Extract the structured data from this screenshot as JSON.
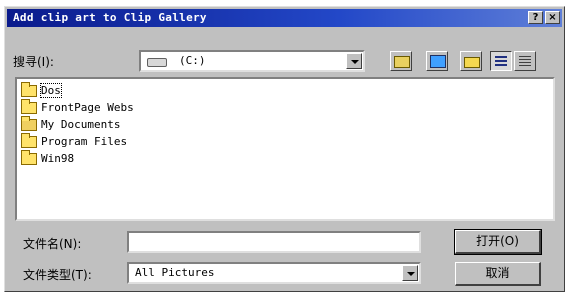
{
  "window": {
    "title": "Add clip art to Clip Gallery",
    "help_label": "?",
    "close_label": "×"
  },
  "lookin": {
    "label": "搜寻(I):",
    "value": "(C:)"
  },
  "toolbar": {
    "icons": [
      "up-folder-icon",
      "desktop-icon",
      "new-folder-icon",
      "list-view-icon",
      "details-view-icon"
    ]
  },
  "files": [
    {
      "label": "Dos"
    },
    {
      "label": "FrontPage Webs"
    },
    {
      "label": "My Documents"
    },
    {
      "label": "Program Files"
    },
    {
      "label": "Win98"
    }
  ],
  "filename": {
    "label": "文件名(N):",
    "value": ""
  },
  "filetype": {
    "label": "文件类型(T):",
    "value": "All Pictures"
  },
  "buttons": {
    "open_label": "打开(O)",
    "cancel_label": "取消"
  }
}
